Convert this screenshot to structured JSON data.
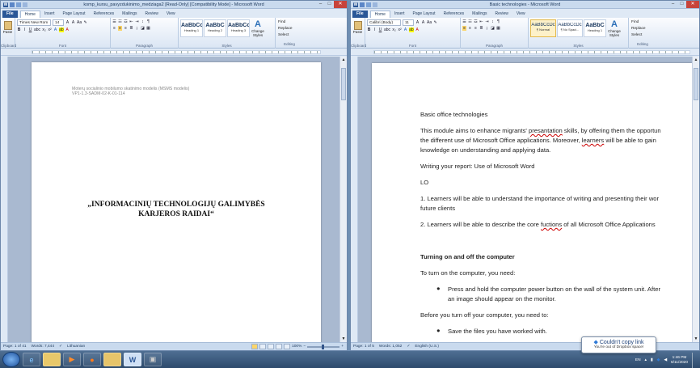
{
  "left_window": {
    "title": "komp_kursu_pavyzdukinimo_medziaga2 [Read-Only] [Compatibility Mode] - Microsoft Word",
    "tabs": [
      "File",
      "Home",
      "Insert",
      "Page Layout",
      "References",
      "Mailings",
      "Review",
      "View"
    ],
    "font": {
      "name": "Times New Rom",
      "size": "14"
    },
    "styles": [
      {
        "preview": "AaBbCcI",
        "name": "Heading 1"
      },
      {
        "preview": "AaBbC",
        "name": "Heading 2"
      },
      {
        "preview": "AaBbCcI",
        "name": "Heading 3"
      }
    ],
    "groups": {
      "clipboard": "Clipboard",
      "font": "Font",
      "paragraph": "Paragraph",
      "styles": "Styles",
      "editing": "Editing"
    },
    "paste": "Paste",
    "change_styles": "Change Styles",
    "edit": {
      "find": "Find",
      "replace": "Replace",
      "select": "Select"
    },
    "header_lines": [
      "Moterų socialinio mobilumo skatinimo modelis (MSMS modelis)",
      "VP1-1.3-SADM-02-K-01-114"
    ],
    "doc_title": [
      "„INFORMACINIŲ TECHNOLOGIJŲ GALIMYBĖS",
      "KARJEROS RAIDAI“"
    ],
    "status": {
      "page": "Page: 1 of 41",
      "words": "Words: 7,444",
      "lang": "Lithuanian",
      "zoom": "100%"
    }
  },
  "right_window": {
    "title": "Basic technologies - Microsoft Word",
    "tabs": [
      "File",
      "Home",
      "Insert",
      "Page Layout",
      "References",
      "Mailings",
      "Review",
      "View"
    ],
    "font": {
      "name": "Calibri (Body)",
      "size": "11"
    },
    "styles": [
      {
        "preview": "AaBbCcDc",
        "name": "¶ Normal"
      },
      {
        "preview": "AaBbCcDc",
        "name": "¶ No Spaci..."
      },
      {
        "preview": "AaBbC",
        "name": "Heading 1"
      }
    ],
    "groups": {
      "clipboard": "Clipboard",
      "font": "Font",
      "paragraph": "Paragraph",
      "styles": "Styles",
      "editing": "Editing"
    },
    "paste": "Paste",
    "change_styles": "Change Styles",
    "edit": {
      "find": "Find",
      "replace": "Replace",
      "select": "Select"
    },
    "body": {
      "heading": "Basic office technologies",
      "p1a": "This module aims to enhance migrants' ",
      "p1b": "presantation",
      "p1c": " skills, by offering them the opportun",
      "p1d": "the different use of Microsoft Office applications. Moreover, ",
      "p1e": " learners",
      "p1f": " will be able to gain",
      "p1g": "knowledge on understanding and applying data.",
      "p2": "Writing your report: Use of Microsoft Word",
      "p3": "LO",
      "p4a": "1. Learners will be able to understand the importance of writing and presenting their wor",
      "p4b": "future clients",
      "p5a": "2. Learners will be able to describe the core ",
      "p5b": "fuctions",
      "p5c": " of all Microsoft Office Applications",
      "h2": "Turning on and off the computer",
      "p6": "To turn on the computer, you need:",
      "b1a": "Press and hold the computer power button on the wall of the system unit. After",
      "b1b": "an image should appear on the monitor.",
      "p7": "Before you turn off your computer, you need to:",
      "b2": "Save the files you have worked with."
    },
    "status": {
      "page": "Page: 1 of 5",
      "words": "Words: 1,052",
      "lang": "English (U.S.)",
      "zoom": "100%"
    }
  },
  "notification": {
    "title": "Couldn't copy link",
    "message": "You're out of Dropbox space!"
  },
  "tray": {
    "lang": "EN",
    "time": "1:46 PM",
    "date": "6/11/2020"
  },
  "taskbar": {
    "word_label": "W"
  }
}
